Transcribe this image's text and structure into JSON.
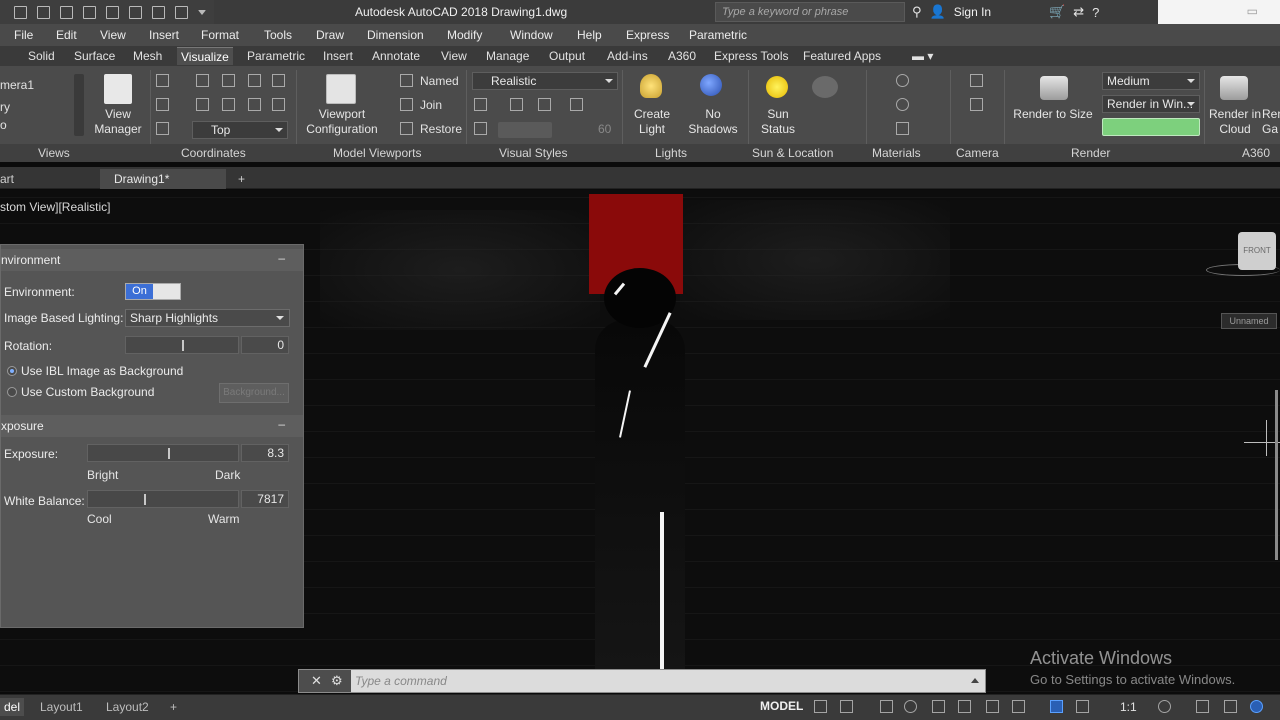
{
  "app": {
    "title": "Autodesk AutoCAD 2018    Drawing1.dwg",
    "search_placeholder": "Type a keyword or phrase",
    "sign_in": "Sign In"
  },
  "menu": [
    "File",
    "Edit",
    "View",
    "Insert",
    "Format",
    "Tools",
    "Draw",
    "Dimension",
    "Modify",
    "Window",
    "Help",
    "Express",
    "Parametric"
  ],
  "ribbon_tabs": [
    "Solid",
    "Surface",
    "Mesh",
    "Visualize",
    "Parametric",
    "Insert",
    "Annotate",
    "View",
    "Manage",
    "Output",
    "Add-ins",
    "A360",
    "Express Tools",
    "Featured Apps"
  ],
  "ribbon_active_tab": "Visualize",
  "ribbon": {
    "views_items": [
      "mera1",
      "ry",
      "o"
    ],
    "view_manager": "View\nManager",
    "coord_top": "Top",
    "viewport_config": "Viewport\nConfiguration",
    "named": "Named",
    "join": "Join",
    "restore": "Restore",
    "visual_style": "Realistic",
    "visual_value": "60",
    "create_light": "Create\nLight",
    "no_shadows": "No\nShadows",
    "sun_status": "Sun\nStatus",
    "render_to_size": "Render to Size",
    "render_quality": "Medium",
    "render_target": "Render in Win...",
    "render_in_cloud": "Render in\nCloud",
    "render_gallery": "Ren\nGa"
  },
  "panel_titles": [
    "Views",
    "Coordinates",
    "Model Viewports",
    "Visual Styles",
    "Lights",
    "Sun & Location",
    "Materials",
    "Camera",
    "Render",
    "A360"
  ],
  "doc_tabs": {
    "start": "art",
    "drawing": "Drawing1*",
    "add": "+"
  },
  "viewport": {
    "label": "stom View][Realistic]",
    "viewcube_face": "FRONT",
    "unnamed": "Unnamed"
  },
  "environment_palette": {
    "section_environment": "nvironment",
    "environment_label": "Environment:",
    "environment_toggle": "On",
    "ibl_label": "Image Based Lighting:",
    "ibl_value": "Sharp Highlights",
    "rotation_label": "Rotation:",
    "rotation_value": "0",
    "use_ibl_bg": "Use IBL Image as Background",
    "use_custom_bg": "Use Custom Background",
    "background_button": "Background...",
    "section_exposure": "xposure",
    "exposure_label": "Exposure:",
    "exposure_value": "8.3",
    "bright": "Bright",
    "dark": "Dark",
    "wb_label": "White Balance:",
    "wb_value": "7817",
    "cool": "Cool",
    "warm": "Warm"
  },
  "command_line": {
    "placeholder": "Type a command"
  },
  "watermark": {
    "line1": "Activate Windows",
    "line2": "Go to Settings to activate Windows."
  },
  "status": {
    "model_tab": "del",
    "layout1": "Layout1",
    "layout2": "Layout2",
    "add": "+",
    "model": "MODEL",
    "scale": "1:1"
  },
  "colors": {
    "accent_toggle": "#3c6fd6",
    "red_object": "#8a0a0a"
  }
}
